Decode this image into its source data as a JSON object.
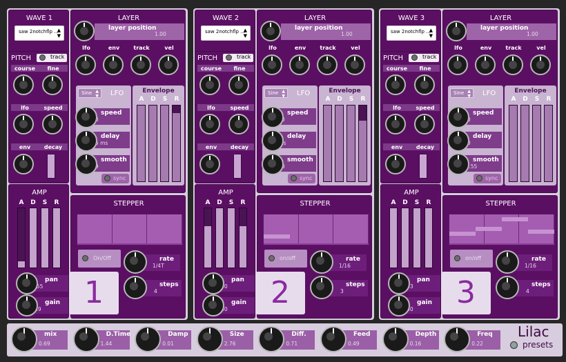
{
  "layers": [
    {
      "wave_title": "WAVE 1",
      "wave_select": "saw 2notchflp ...",
      "layer_title": "LAYER",
      "layer_position_label": "layer position",
      "layer_position_value": "1.00",
      "mod_labels": [
        "lfo",
        "env",
        "track",
        "vel"
      ],
      "pitch_title": "PITCH",
      "track_label": "track",
      "course_label": "course",
      "fine_label": "fine",
      "lfo_label": "lfo",
      "speed_label": "speed",
      "env_label": "env",
      "decay_label": "decay",
      "lfo_shape": "Sine",
      "lfo_title": "LFO",
      "lfo_speed_label": "speed",
      "lfo_speed_value": "5.10",
      "lfo_delay_label": "delay",
      "lfo_delay_value": "0.05 ms",
      "lfo_smooth_label": "smooth",
      "lfo_smooth_value": "3.09",
      "sync_label": "sync",
      "envelope_title": "Envelope",
      "env_letters": [
        "A",
        "D",
        "S",
        "R"
      ],
      "amp_title": "AMP",
      "amp_letters": [
        "A",
        "D",
        "S",
        "R"
      ],
      "pan_label": "pan",
      "pan_value": "-0.55",
      "gain_label": "gain",
      "gain_value": "0.49",
      "stepper_title": "STEPPER",
      "onoff_label": "On/Off",
      "rate_label": "rate",
      "rate_value": "1/4T",
      "steps_label": "steps",
      "steps_value": "4",
      "number": "1",
      "amp_levels": [
        0.9,
        0.0,
        0.0,
        0.0
      ],
      "env_levels": [
        0.0,
        0.0,
        0.0,
        0.1
      ],
      "step_levels": [
        0.0,
        0.0,
        0.0,
        0.0
      ]
    },
    {
      "wave_title": "WAVE 2",
      "wave_select": "saw 2notchflp ...",
      "layer_title": "LAYER",
      "layer_position_label": "layer position",
      "layer_position_value": "1.00",
      "mod_labels": [
        "lfo",
        "env",
        "track",
        "vel"
      ],
      "pitch_title": "PITCH",
      "track_label": "track",
      "course_label": "course",
      "fine_label": "fine",
      "lfo_label": "lfo",
      "speed_label": "speed",
      "env_label": "env",
      "decay_label": "decay",
      "lfo_shape": "Sine",
      "lfo_title": "LFO",
      "lfo_speed_label": "speed",
      "lfo_speed_value": "0.10",
      "lfo_delay_label": "delay",
      "lfo_delay_value": "0 ms",
      "lfo_smooth_label": "smooth",
      "lfo_smooth_value": "0.00",
      "sync_label": "sync",
      "envelope_title": "Envelope",
      "env_letters": [
        "A",
        "D",
        "S",
        "R"
      ],
      "amp_title": "AMP",
      "amp_letters": [
        "A",
        "D",
        "S",
        "R"
      ],
      "pan_label": "pan",
      "pan_value": "0.00",
      "gain_label": "gain",
      "gain_value": "0.50",
      "stepper_title": "STEPPER",
      "onoff_label": "on/off",
      "rate_label": "rate",
      "rate_value": "1/16",
      "steps_label": "steps",
      "steps_value": "3",
      "number": "2",
      "amp_levels": [
        0.3,
        0.0,
        0.0,
        0.3
      ],
      "env_levels": [
        0.0,
        0.0,
        0.0,
        0.2
      ],
      "step_levels": [
        0.2,
        0.0,
        0.0,
        0.0
      ]
    },
    {
      "wave_title": "WAVE 3",
      "wave_select": "saw 2notchflp ...",
      "layer_title": "LAYER",
      "layer_position_label": "layer position",
      "layer_position_value": "1.00",
      "mod_labels": [
        "lfo",
        "env",
        "track",
        "vel"
      ],
      "pitch_title": "PITCH",
      "track_label": "track",
      "course_label": "course",
      "fine_label": "fine",
      "lfo_label": "lfo",
      "speed_label": "speed",
      "env_label": "env",
      "decay_label": "decay",
      "lfo_shape": "Sine",
      "lfo_title": "LFO",
      "lfo_speed_label": "speed",
      "lfo_speed_value": "0.10",
      "lfo_delay_label": "delay",
      "lfo_delay_value": "0.00",
      "lfo_smooth_label": "smooth",
      "lfo_smooth_value": "123.55",
      "sync_label": "sync",
      "envelope_title": "Envelope",
      "env_letters": [
        "A",
        "D",
        "S",
        "R"
      ],
      "amp_title": "AMP",
      "amp_letters": [
        "A",
        "D",
        "S",
        "R"
      ],
      "pan_label": "pan",
      "pan_value": "0.33",
      "gain_label": "gain",
      "gain_value": "0.50",
      "stepper_title": "STEPPER",
      "onoff_label": "on/off",
      "rate_label": "rate",
      "rate_value": "1/16",
      "steps_label": "steps",
      "steps_value": "4",
      "number": "3",
      "amp_levels": [
        0.0,
        0.0,
        0.0,
        0.0
      ],
      "env_levels": [
        0.0,
        0.0,
        0.0,
        0.0
      ],
      "step_levels": [
        0.3,
        0.5,
        0.9,
        0.4
      ]
    }
  ],
  "fx": [
    {
      "label": "mix",
      "value": "0.69"
    },
    {
      "label": "D.Time",
      "value": "1.44"
    },
    {
      "label": "Damp",
      "value": "0.01"
    },
    {
      "label": "Size",
      "value": "2.76"
    },
    {
      "label": "Diff.",
      "value": "0.71"
    },
    {
      "label": "Feed",
      "value": "0.49"
    },
    {
      "label": "Depth",
      "value": "0.16"
    },
    {
      "label": "Freq",
      "value": "0.22"
    }
  ],
  "brand": "Lilac",
  "presets_label": "presets",
  "colors": {
    "panel": "#5b0f63",
    "frame": "#d8cdde",
    "accent": "#9e64a8",
    "number": "#8a2aa0"
  }
}
